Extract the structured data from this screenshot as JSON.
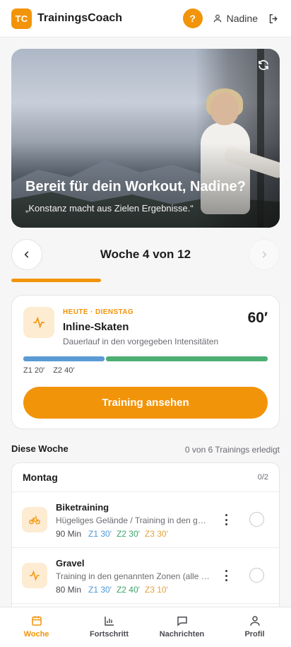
{
  "header": {
    "logo": "TC",
    "app_name": "TrainingsCoach",
    "help_label": "?",
    "user_name": "Nadine"
  },
  "hero": {
    "title": "Bereit für dein Workout, Nadine?",
    "quote": "„Konstanz macht aus Zielen Ergebnisse.“"
  },
  "week_nav": {
    "title": "Woche 4 von 12",
    "progress_fraction": 0.333
  },
  "today": {
    "label": "HEUTE · DIENSTAG",
    "name": "Inline-Skaten",
    "description": "Dauerlauf in den vorgegeben Intensitäten",
    "duration": "60′",
    "zones": [
      {
        "label": "Z1 20′",
        "minutes": 20,
        "color": "#5b9bd5"
      },
      {
        "label": "Z2 40′",
        "minutes": 40,
        "color": "#4caf74"
      }
    ],
    "cta": "Training ansehen"
  },
  "this_week": {
    "title": "Diese Woche",
    "count": "0 von 6 Trainings erledigt",
    "day": {
      "name": "Montag",
      "count": "0/2",
      "workouts": [
        {
          "title": "Biketraining",
          "description": "Hügeliges Gelände / Training in den genannten Zonen",
          "minutes": "90 Min",
          "z1": "Z1 30′",
          "z2": "Z2 30′",
          "z3": "Z3 30′",
          "icon": "bike-icon"
        },
        {
          "title": "Gravel",
          "description": "Training in den genannten Zonen (alle Zonen)",
          "minutes": "80 Min",
          "z1": "Z1 30′",
          "z2": "Z2 40′",
          "z3": "Z3 10′",
          "icon": "activity-icon"
        }
      ]
    }
  },
  "bottom_nav": {
    "items": [
      {
        "label": "Woche",
        "icon": "calendar-icon",
        "active": true
      },
      {
        "label": "Fortschritt",
        "icon": "bar-chart-icon",
        "active": false
      },
      {
        "label": "Nachrichten",
        "icon": "message-icon",
        "active": false
      },
      {
        "label": "Profil",
        "icon": "user-icon",
        "active": false
      }
    ]
  },
  "colors": {
    "accent": "#f29409",
    "zone1": "#4b98d8",
    "zone2": "#3ea36b",
    "zone3": "#e2a23a"
  }
}
